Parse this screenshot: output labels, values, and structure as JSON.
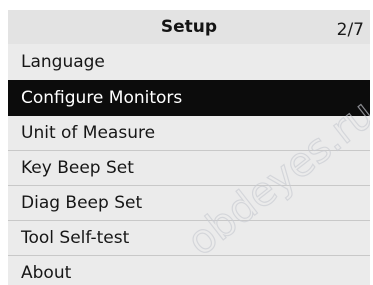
{
  "header": {
    "title": "Setup",
    "page_indicator": "2/7"
  },
  "menu": {
    "items": [
      {
        "label": "Language"
      },
      {
        "label": "Configure Monitors",
        "selected": true
      },
      {
        "label": "Unit of Measure"
      },
      {
        "label": "Key Beep Set"
      },
      {
        "label": "Diag Beep Set"
      },
      {
        "label": "Tool Self-test"
      },
      {
        "label": "About"
      }
    ]
  },
  "watermark": {
    "text": "obdeyes.ru"
  },
  "colors": {
    "background": "#ebebeb",
    "header_background": "#e3e3e3",
    "selected_background": "#0c0c0c",
    "selected_text": "#ffffff",
    "text": "#161616",
    "divider": "#c8c8c8"
  }
}
